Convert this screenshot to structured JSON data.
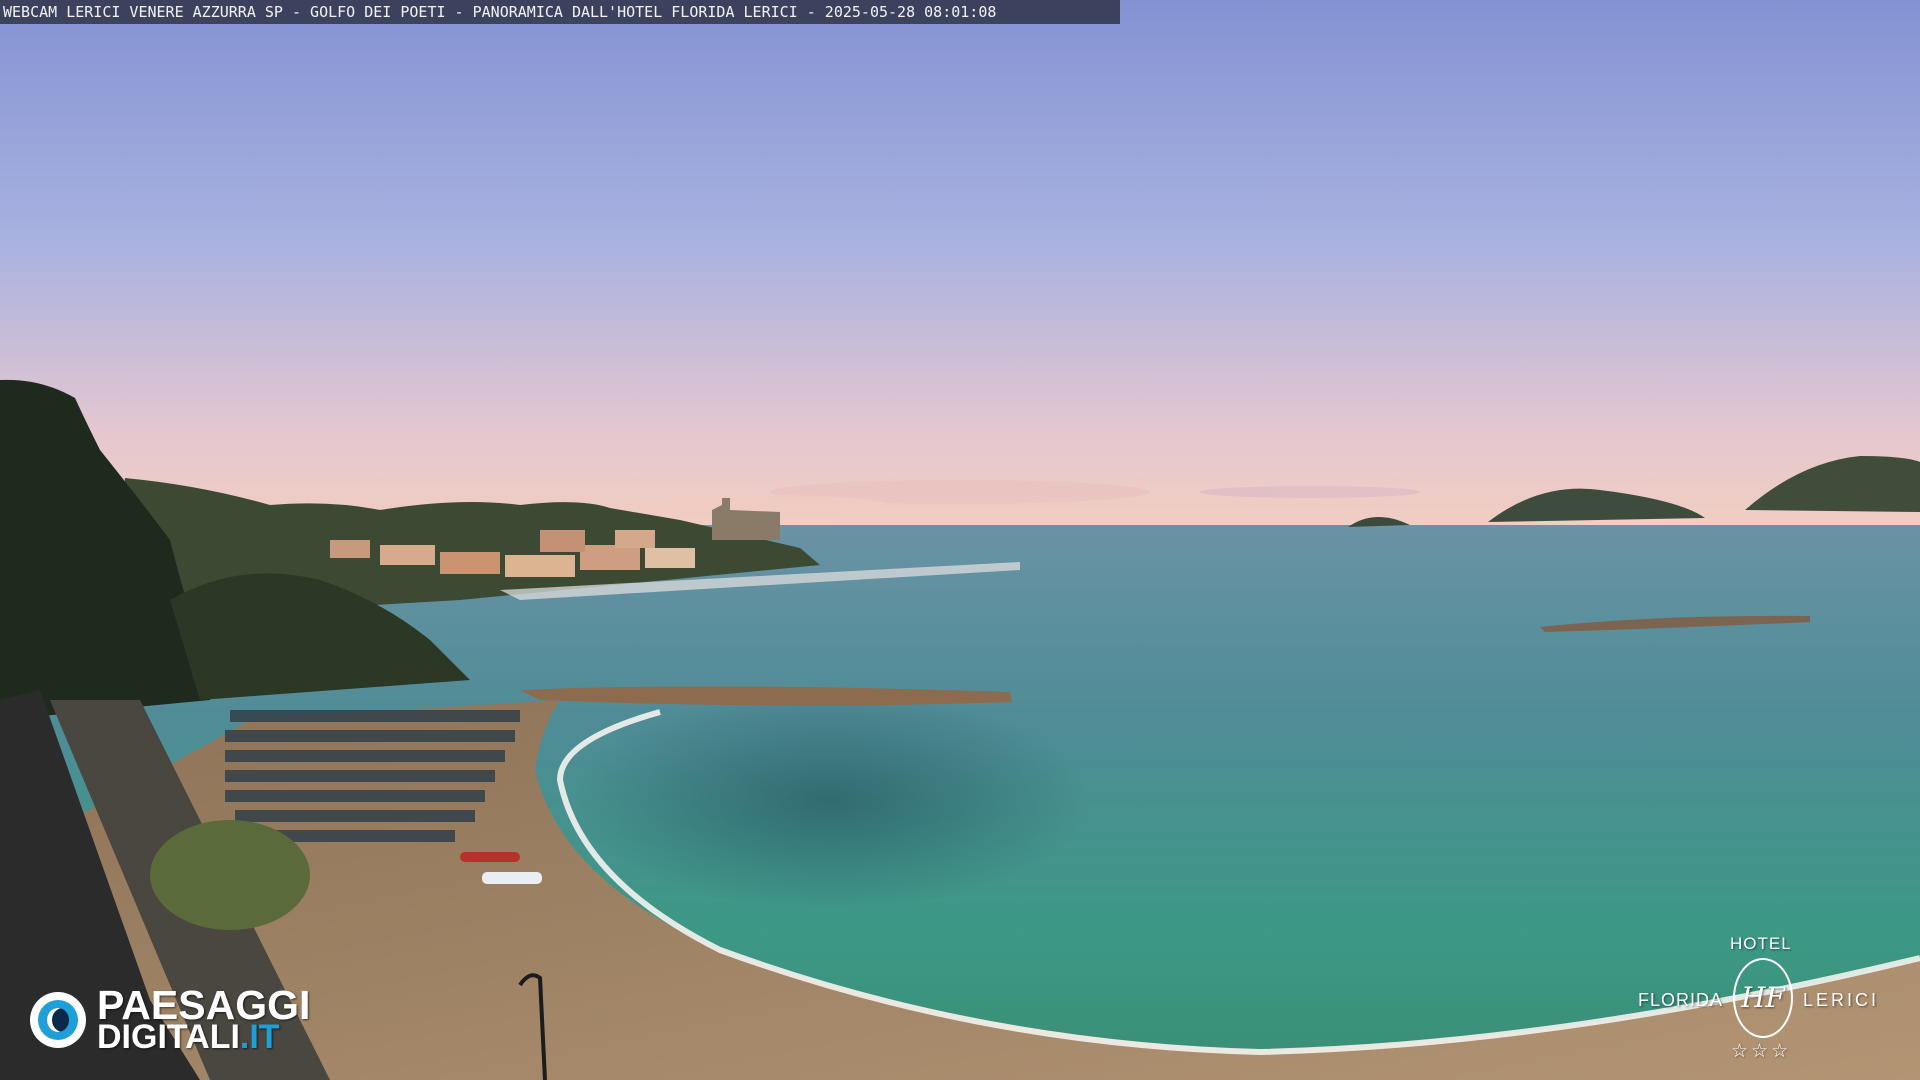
{
  "banner": {
    "text": "WEBCAM LERICI VENERE AZZURRA SP - GOLFO DEI POETI - PANORAMICA DALL'HOTEL FLORIDA LERICI - 2025-05-28 08:01:08"
  },
  "logo_left": {
    "line1": "PAESAGGI",
    "line2": "DIGITALI",
    "suffix": ".IT",
    "icon": "eye-icon",
    "accent_color": "#1f9fd8"
  },
  "logo_right": {
    "hotel": "HOTEL",
    "florida": "FLORIDA",
    "lerici": "LERICI",
    "monogram": "HF",
    "stars": "☆☆☆"
  },
  "colors": {
    "sky_top": "#8e9ed8",
    "sky_horizon": "#f0c9c0",
    "sea_far": "#5d8e9a",
    "sea_near": "#3f9a86",
    "sand": "#a98a6a",
    "foliage": "#2b3b25"
  }
}
